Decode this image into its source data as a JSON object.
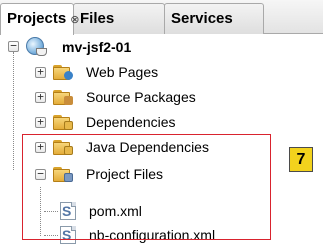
{
  "tabs": [
    {
      "label": "Projects",
      "close": "⊗"
    },
    {
      "label": "Files"
    },
    {
      "label": "Services"
    }
  ],
  "tree": {
    "root": {
      "label": "mv-jsf2-01",
      "expander": "−"
    },
    "items": [
      {
        "label": "Web Pages",
        "expander": "+",
        "icon": "web-pages-folder-icon"
      },
      {
        "label": "Source Packages",
        "expander": "+",
        "icon": "source-packages-folder-icon"
      },
      {
        "label": "Dependencies",
        "expander": "+",
        "icon": "dependencies-folder-icon"
      },
      {
        "label": "Java Dependencies",
        "expander": "+",
        "icon": "java-dependencies-folder-icon"
      },
      {
        "label": "Project Files",
        "expander": "−",
        "icon": "project-files-folder-icon"
      }
    ],
    "project_files": [
      {
        "label": "pom.xml",
        "icon": "xml-file-icon"
      },
      {
        "label": "nb-configuration.xml",
        "icon": "xml-file-icon"
      }
    ]
  },
  "annotation": {
    "step": "7",
    "highlight_color": "#d9232e",
    "badge_color": "#f2d21d"
  }
}
